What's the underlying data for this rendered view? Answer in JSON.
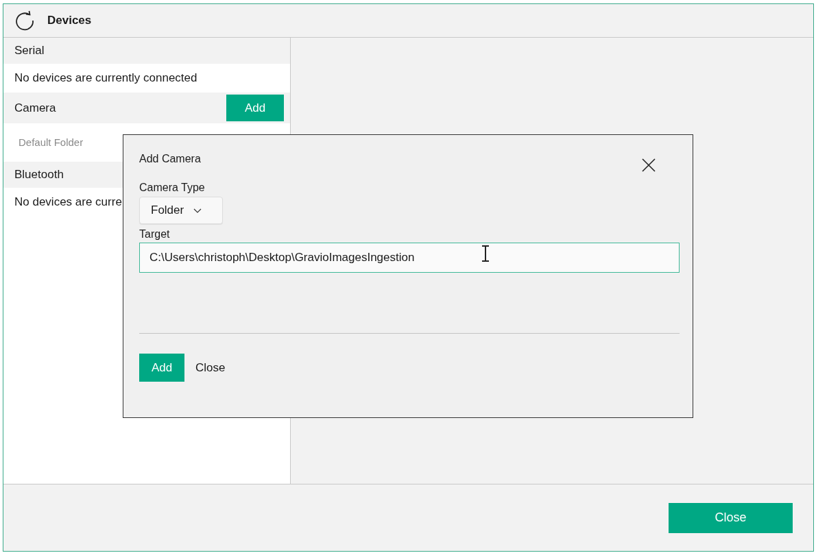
{
  "window": {
    "title": "Devices"
  },
  "sections": [
    {
      "kind": "header",
      "label": "Serial"
    },
    {
      "kind": "item",
      "label": "No devices are currently connected",
      "muted": false
    },
    {
      "kind": "header",
      "label": "Camera",
      "button": "Add"
    },
    {
      "kind": "item",
      "label": "Default Folder",
      "muted": true
    },
    {
      "kind": "header",
      "label": "Bluetooth"
    },
    {
      "kind": "item",
      "label": "No devices are curre",
      "muted": false
    }
  ],
  "dialog": {
    "title": "Add Camera",
    "camera_type_label": "Camera Type",
    "camera_type": "Folder",
    "target_label": "Target",
    "target_value": "C:\\Users\\christoph\\Desktop\\GravioImagesIngestion",
    "add": "Add",
    "close": "Close"
  },
  "footer": {
    "close": "Close"
  }
}
